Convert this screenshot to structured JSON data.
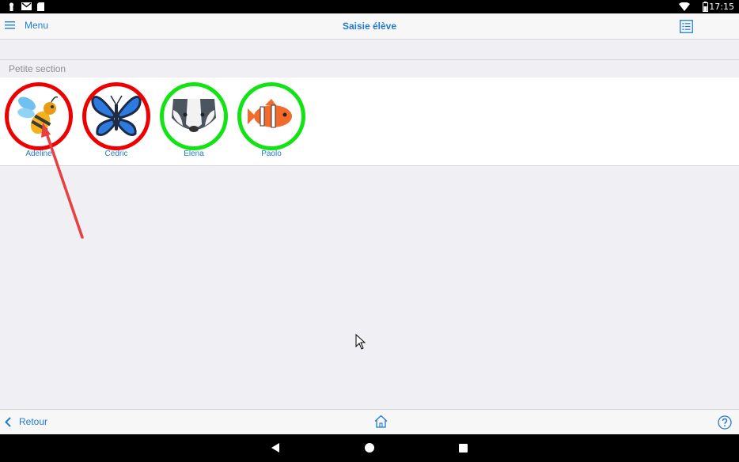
{
  "status_bar": {
    "time": "17:15",
    "left_icons": [
      "keyhole-icon",
      "gmail-icon",
      "sd-card-icon"
    ],
    "right_icons": [
      "wifi-icon",
      "battery-icon"
    ]
  },
  "nav": {
    "menu_label": "Menu",
    "title": "Saisie élève",
    "list_icon": "list-icon"
  },
  "section": {
    "title": "Petite section"
  },
  "students": [
    {
      "name": "Adeline",
      "avatar": "bee-icon",
      "status": "absent",
      "ring_color": "#ee0000"
    },
    {
      "name": "Cedric",
      "avatar": "butterfly-icon",
      "status": "absent",
      "ring_color": "#ee0000"
    },
    {
      "name": "Elena",
      "avatar": "badger-icon",
      "status": "present",
      "ring_color": "#12e312"
    },
    {
      "name": "Paolo",
      "avatar": "clownfish-icon",
      "status": "present",
      "ring_color": "#12e312"
    }
  ],
  "toolbar": {
    "back_label": "Retour",
    "home_icon": "home-icon",
    "help_icon": "help-icon"
  },
  "colors": {
    "accent": "#1f7bd3",
    "absent": "#ee0000",
    "present": "#12e312",
    "annotation_arrow": "#e84040"
  }
}
